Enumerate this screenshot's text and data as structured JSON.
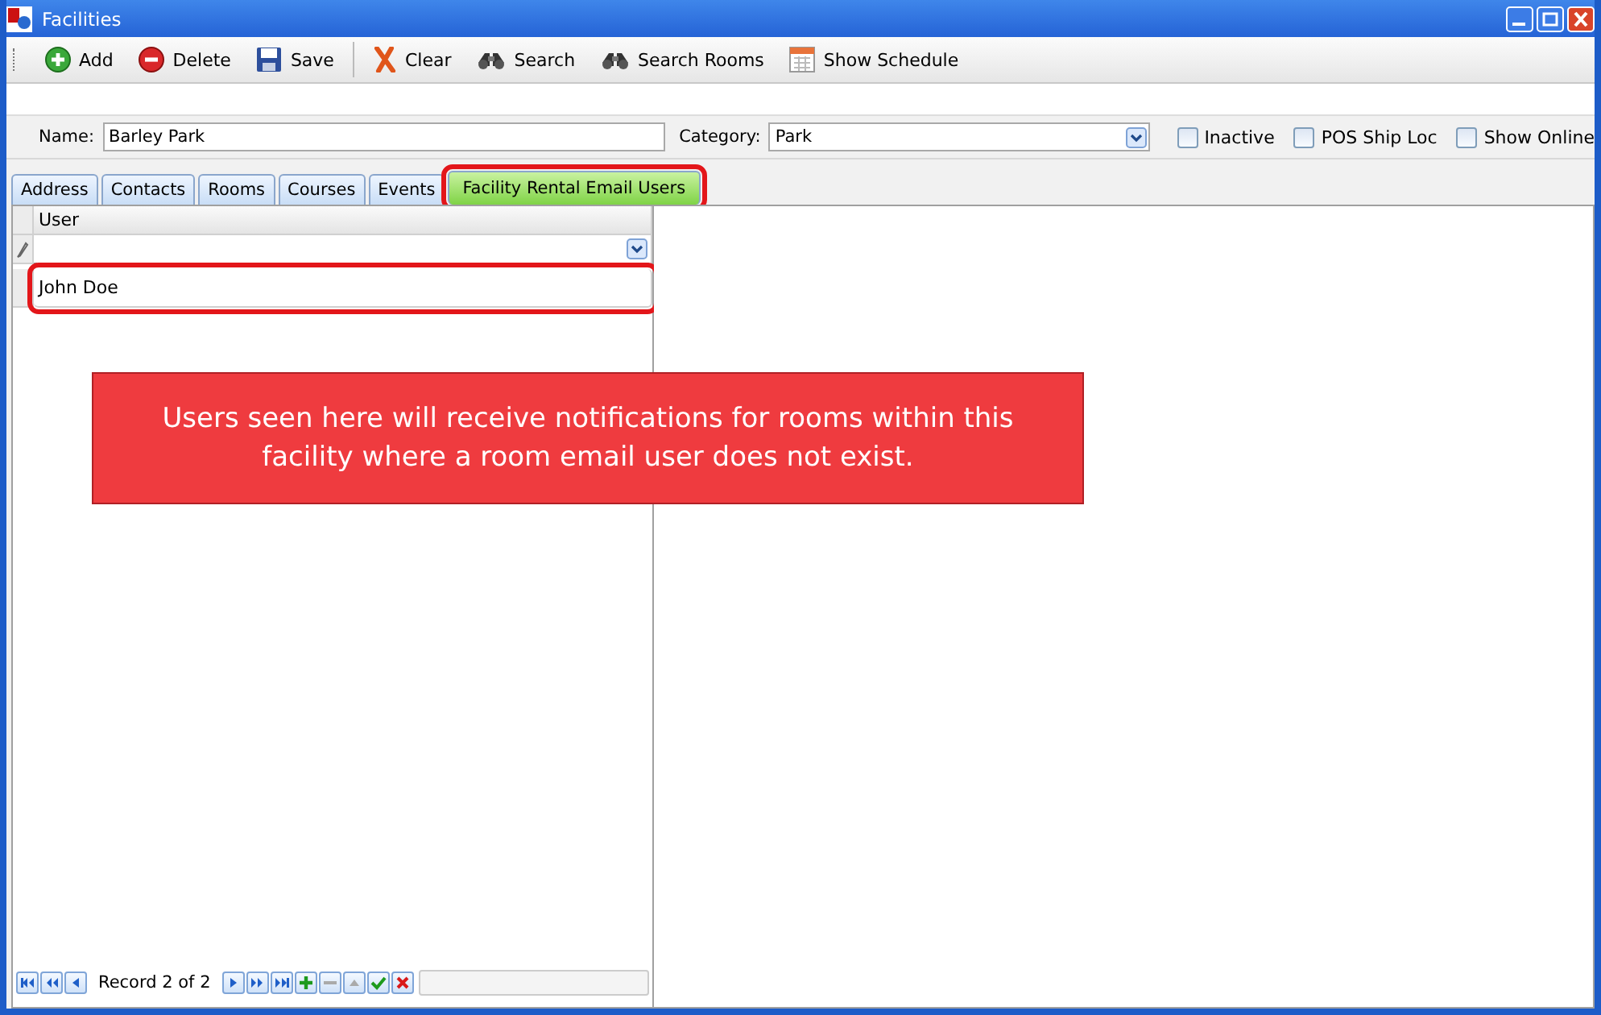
{
  "window": {
    "title": "Facilities"
  },
  "toolbar": [
    {
      "label": "Add",
      "kind": "add"
    },
    {
      "label": "Delete",
      "kind": "delete"
    },
    {
      "label": "Save",
      "kind": "save"
    },
    {
      "label": "Clear",
      "kind": "clear"
    },
    {
      "label": "Search",
      "kind": "search"
    },
    {
      "label": "Search Rooms",
      "kind": "search"
    },
    {
      "label": "Show Schedule",
      "kind": "schedule"
    }
  ],
  "form": {
    "name_label": "Name:",
    "name_value": "Barley Park",
    "category_label": "Category:",
    "category_value": "Park",
    "checkboxes": [
      {
        "label": "Inactive",
        "checked": false
      },
      {
        "label": "POS Ship Loc",
        "checked": false
      },
      {
        "label": "Show Online",
        "checked": false
      }
    ]
  },
  "tabs": [
    {
      "label": "Address",
      "selected": false,
      "highlighted": false
    },
    {
      "label": "Contacts",
      "selected": false,
      "highlighted": false
    },
    {
      "label": "Rooms",
      "selected": false,
      "highlighted": false
    },
    {
      "label": "Courses",
      "selected": false,
      "highlighted": false
    },
    {
      "label": "Events",
      "selected": false,
      "highlighted": false
    },
    {
      "label": "Facility Rental Email Users",
      "selected": true,
      "highlighted": true
    }
  ],
  "grid": {
    "columns": [
      "User"
    ],
    "rows": [
      {
        "user": "John Doe",
        "highlighted": true
      }
    ]
  },
  "callout": {
    "text": "Users seen here will receive notifications for rooms within this facility where a room email user does not exist."
  },
  "navigator": {
    "record_text": "Record 2 of 2"
  }
}
